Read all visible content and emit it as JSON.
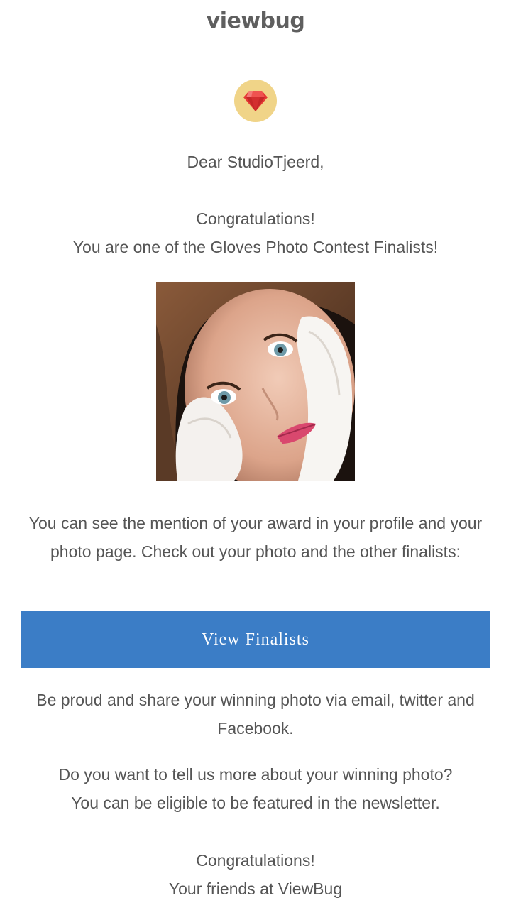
{
  "header": {
    "logo_text": "viewbug"
  },
  "badge": {
    "icon": "ruby-gem-icon",
    "background": "#f0d488",
    "gem_color": "#e53935"
  },
  "greeting": "Dear StudioTjeerd,",
  "congrats_line": "Congratulations!",
  "finalist_line": "You are one of the Gloves Photo Contest Finalists!",
  "photo": {
    "subject": "portrait of a woman with white gloves on her face"
  },
  "award_paragraph": "You can see the mention of your award in your profile and your photo page. Check out your photo and the other finalists:",
  "cta": {
    "label": "View Finalists",
    "color": "#3b7dc6"
  },
  "share_paragraph": "Be proud and share your winning photo via email, twitter and Facebook.",
  "feature_line_1": "Do you want to tell us more about your winning photo?",
  "feature_line_2": "You can be eligible to be featured in the newsletter.",
  "closing_line_1": "Congratulations!",
  "closing_line_2": "Your friends at ViewBug",
  "colors": {
    "text": "#555555",
    "accent": "#3b7dc6"
  }
}
